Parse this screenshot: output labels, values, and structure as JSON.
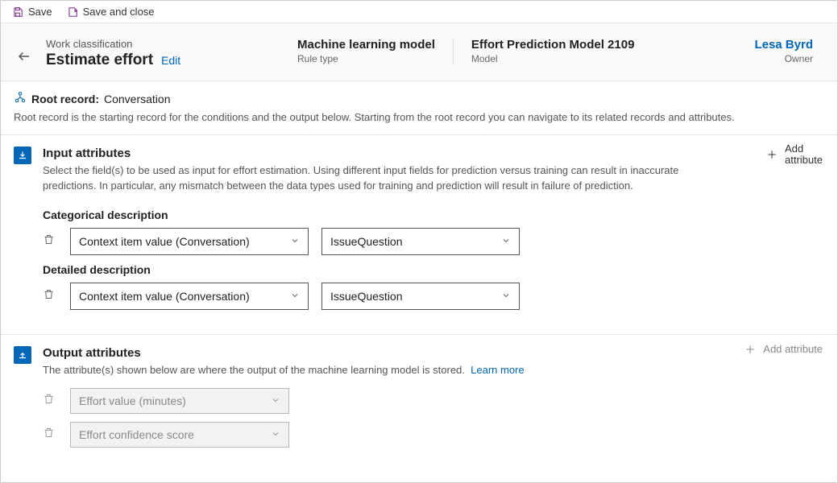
{
  "toolbar": {
    "save": "Save",
    "save_close": "Save and close"
  },
  "header": {
    "breadcrumb": "Work classification",
    "title": "Estimate effort",
    "edit": "Edit",
    "rule_type_value": "Machine learning model",
    "rule_type_label": "Rule type",
    "model_value": "Effort Prediction Model 2109",
    "model_label": "Model",
    "owner_name": "Lesa Byrd",
    "owner_label": "Owner"
  },
  "root": {
    "title_label": "Root record:",
    "title_value": "Conversation",
    "desc": "Root record is the starting record for the conditions and the output below. Starting from the root record you can navigate to its related records and attributes."
  },
  "input": {
    "title": "Input attributes",
    "desc": "Select the field(s) to be used as input for effort estimation. Using different input fields for prediction versus training can result in inaccurate predictions. In particular, any mismatch between the data types used for training and prediction will result in failure of prediction.",
    "add_line1": "Add",
    "add_line2": "attribute",
    "rows": [
      {
        "label": "Categorical description",
        "field": "Context item value (Conversation)",
        "value": "IssueQuestion"
      },
      {
        "label": "Detailed description",
        "field": "Context item value (Conversation)",
        "value": "IssueQuestion"
      }
    ]
  },
  "output": {
    "title": "Output attributes",
    "desc": "The attribute(s) shown below are where the output of the machine learning model is stored.",
    "learn": "Learn more",
    "add": "Add attribute",
    "rows": [
      {
        "value": "Effort value (minutes)"
      },
      {
        "value": "Effort confidence score"
      }
    ]
  }
}
